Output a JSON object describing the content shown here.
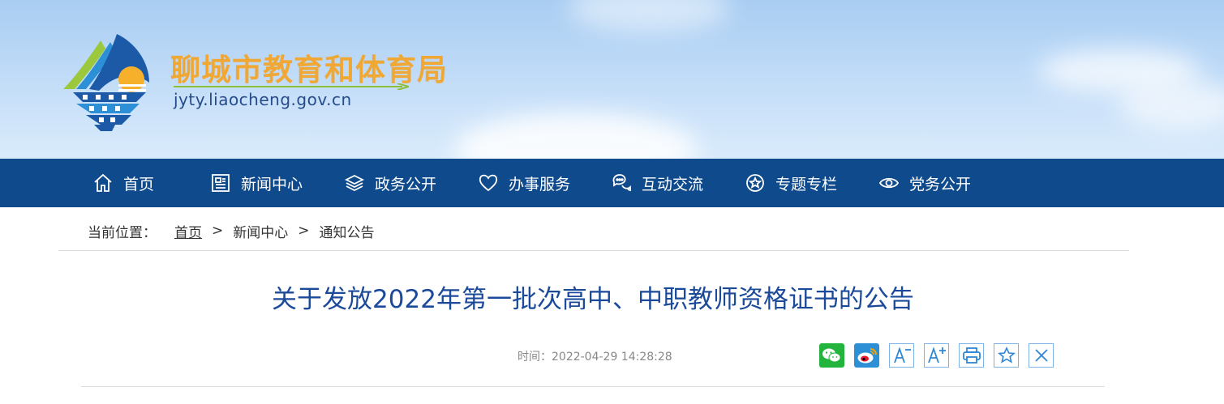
{
  "site": {
    "title": "聊城市教育和体育局",
    "url": "jyty.liaocheng.gov.cn"
  },
  "nav": {
    "items": [
      {
        "label": "首页",
        "icon": "home-icon"
      },
      {
        "label": "新闻中心",
        "icon": "newspaper-icon"
      },
      {
        "label": "政务公开",
        "icon": "layers-icon"
      },
      {
        "label": "办事服务",
        "icon": "heart-icon"
      },
      {
        "label": "互动交流",
        "icon": "chat-bubbles-icon"
      },
      {
        "label": "专题专栏",
        "icon": "star-circle-icon"
      },
      {
        "label": "党务公开",
        "icon": "eye-icon"
      }
    ]
  },
  "breadcrumb": {
    "prefix": "当前位置：",
    "items": [
      "首页",
      "新闻中心",
      "通知公告"
    ],
    "separator": ">"
  },
  "article": {
    "title": "关于发放2022年第一批次高中、中职教师资格证书的公告",
    "meta": "时间：2022-04-29 14:28:28"
  },
  "tools": [
    "wechat-share-icon",
    "weibo-share-icon",
    "font-decrease-icon",
    "font-increase-icon",
    "print-icon",
    "favorite-icon",
    "close-icon"
  ],
  "colors": {
    "nav_bg": "#0f4a8c",
    "title_orange": "#f0a733",
    "article_title_blue": "#1b4a9a",
    "tool_blue": "#2f87d6",
    "wechat_green": "#22b43c"
  }
}
